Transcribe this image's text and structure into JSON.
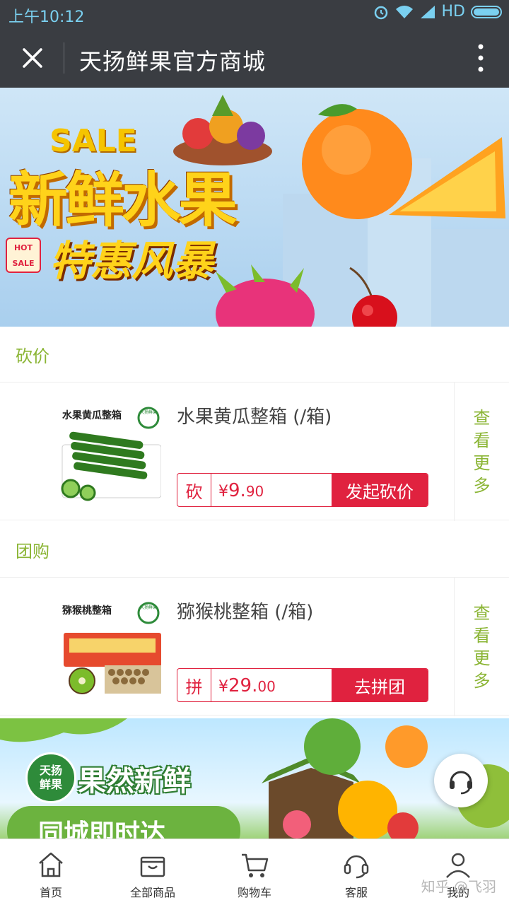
{
  "status": {
    "time": "上午10:12",
    "network": "HD"
  },
  "header": {
    "title": "天扬鲜果官方商城"
  },
  "banner_top": {
    "sale": "SALE",
    "headline": "新鲜水果",
    "subline": "特惠风暴",
    "badge_line1": "HOT",
    "badge_line2": "SALE"
  },
  "sections": [
    {
      "title": "砍价",
      "product": {
        "img_caption": "水果黄瓜整箱",
        "brand_mark": "天扬鲜果",
        "name": "水果黄瓜整箱 (/箱)",
        "tag": "砍",
        "currency": "¥",
        "price_int": "9.",
        "price_dec": "90",
        "action": "发起砍价"
      },
      "more": [
        "查",
        "看",
        "更",
        "多"
      ]
    },
    {
      "title": "团购",
      "product": {
        "img_caption": "猕猴桃整箱",
        "brand_mark": "天扬鲜果",
        "name": "猕猴桃整箱 (/箱)",
        "tag": "拼",
        "currency": "¥",
        "price_int": "29.",
        "price_dec": "00",
        "action": "去拼团"
      },
      "more": [
        "查",
        "看",
        "更",
        "多"
      ]
    }
  ],
  "banner_bottom": {
    "logo_line1": "天扬",
    "logo_line2": "鲜果",
    "slogan1": "果然新鲜",
    "slogan2": "同城即时达"
  },
  "tabs": [
    {
      "label": "首页",
      "icon": "home-icon"
    },
    {
      "label": "全部商品",
      "icon": "shopping-bag-icon"
    },
    {
      "label": "购物车",
      "icon": "cart-icon"
    },
    {
      "label": "客服",
      "icon": "headset-icon"
    },
    {
      "label": "我的",
      "icon": "user-icon"
    }
  ],
  "watermark": "知乎 @飞羽",
  "colors": {
    "accent_red": "#e0223f",
    "section_green": "#8bb535",
    "bar_dark": "#3a3d42"
  }
}
